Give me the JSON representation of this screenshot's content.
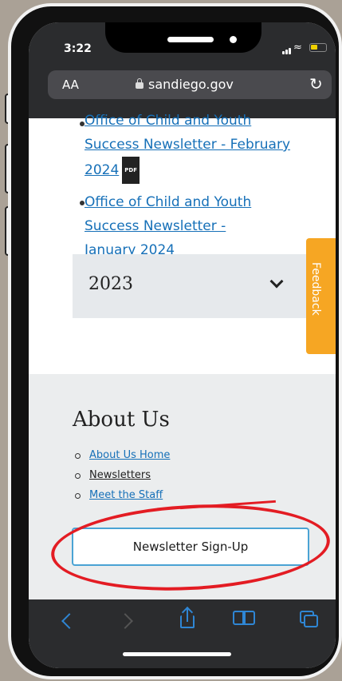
{
  "status": {
    "time": "3:22"
  },
  "browser": {
    "text_size": "AA",
    "domain": "sandiego.gov"
  },
  "newsletters": [
    {
      "title": "Office of Child and Youth",
      "line2": "Success Newsletter - February",
      "line3": "2024",
      "badge": "PDF"
    },
    {
      "title": "Office of Child and Youth",
      "line2": "Success Newsletter -",
      "line3": "January 2024"
    }
  ],
  "year_accordion": {
    "label": "2023"
  },
  "feedback_tab": {
    "label": "Feedback"
  },
  "about": {
    "heading": "About Us",
    "links": [
      "About Us Home",
      "Newsletters",
      "Meet the Staff"
    ]
  },
  "signup_button": {
    "label": "Newsletter Sign-Up"
  },
  "colors": {
    "link": "#1670b8",
    "feedback": "#f6a623",
    "annotation": "#e31c23",
    "toolbar_icon": "#2f86d4"
  },
  "icons": [
    "lock-icon",
    "reload-icon",
    "back-icon",
    "forward-icon",
    "share-icon",
    "bookmarks-icon",
    "tabs-icon",
    "chevron-down-icon"
  ]
}
